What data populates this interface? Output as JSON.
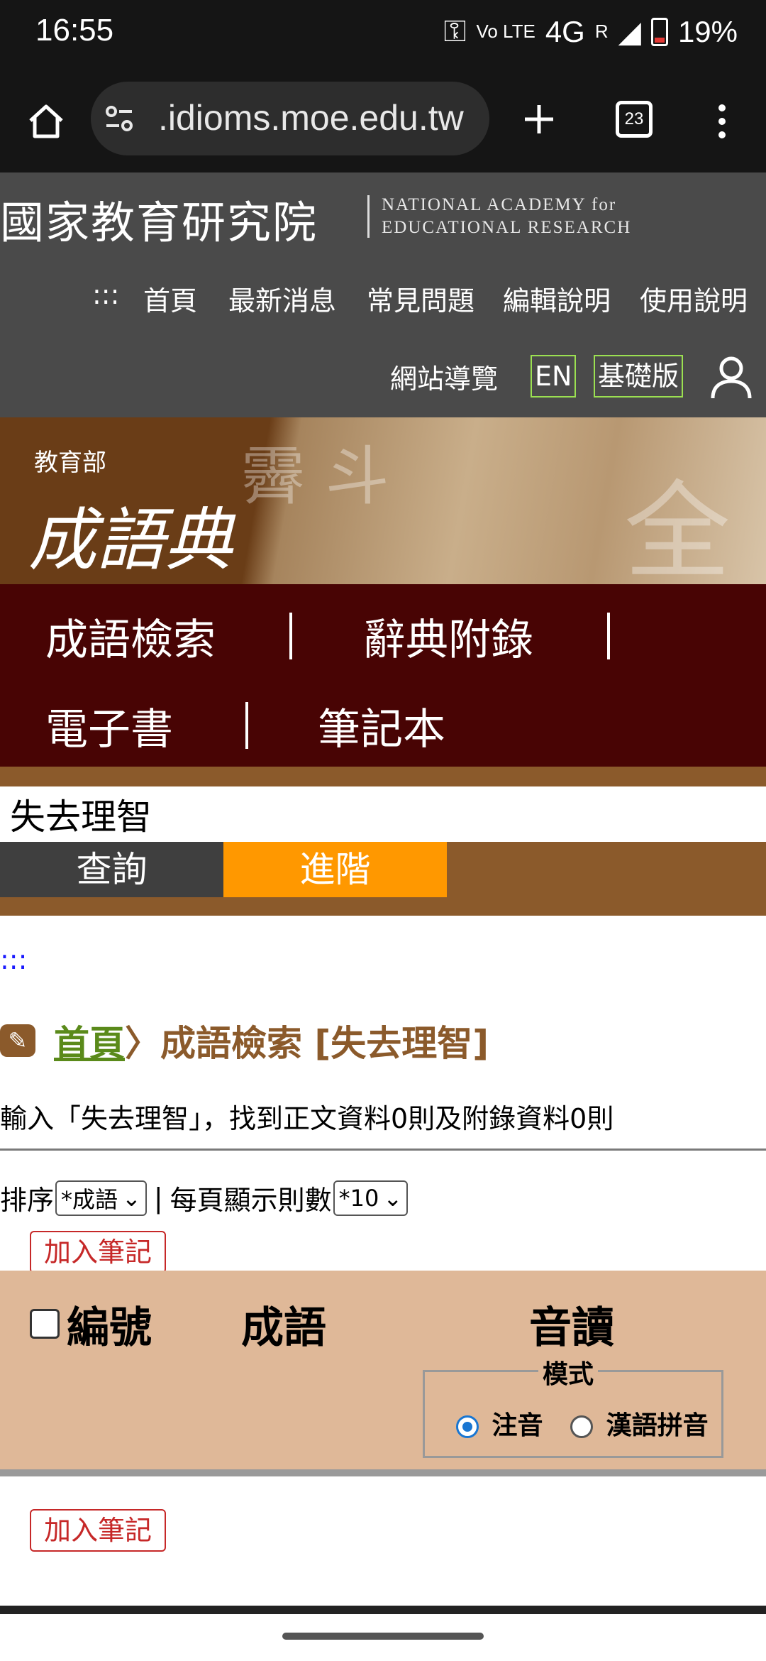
{
  "status_bar": {
    "time": "16:55",
    "network": "4G",
    "volte": "Vo LTE",
    "roaming": "R",
    "battery": "19%"
  },
  "browser": {
    "url": ".idioms.moe.edu.tw",
    "tab_count": "23"
  },
  "header": {
    "logo_cn": "國家教育研究院",
    "logo_en_line1": "NATIONAL ACADEMY for",
    "logo_en_line2": "EDUCATIONAL RESEARCH",
    "nav_dots": ":::",
    "nav": [
      "首頁",
      "最新消息",
      "常見問題",
      "編輯說明",
      "使用說明"
    ],
    "sitemap": "網站導覽",
    "en": "EN",
    "basic": "基礎版"
  },
  "banner": {
    "small": "教育部",
    "title": "成語典"
  },
  "menu": {
    "items": [
      "成語檢索",
      "辭典附錄",
      "電子書",
      "筆記本"
    ],
    "separator": "|"
  },
  "search": {
    "value": "失去理智",
    "query_label": "查詢",
    "advanced_label": "進階"
  },
  "content": {
    "blue_dots": ":::",
    "breadcrumb_home": "首頁",
    "breadcrumb_arrow": "〉",
    "breadcrumb_current": "成語檢索 [失去理智]",
    "result_text": "輸入「失去理智」，找到正文資料0則及附錄資料0則",
    "sort_label": "排序",
    "sort_value": "*成語",
    "divider": "|",
    "per_page_label": "每頁顯示則數",
    "per_page_value": "*10",
    "add_note": "加入筆記"
  },
  "table": {
    "col_number": "編號",
    "col_idiom": "成語",
    "col_pronunciation": "音讀",
    "mode_label": "模式",
    "mode_options": [
      "注音",
      "漢語拼音"
    ],
    "mode_selected": "注音"
  }
}
